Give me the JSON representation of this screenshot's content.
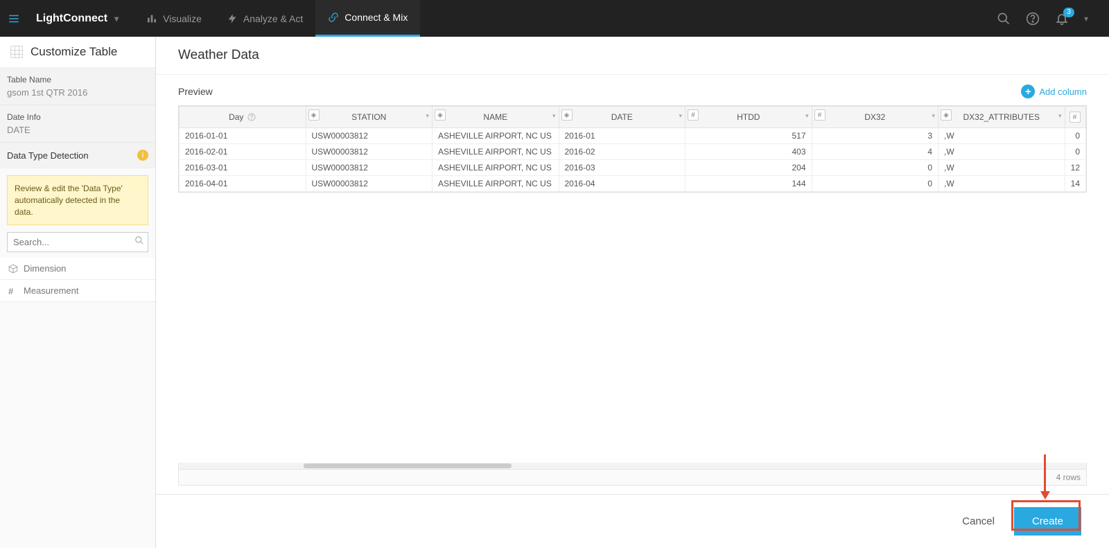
{
  "app": {
    "brand": "LightConnect"
  },
  "nav": {
    "tabs": [
      {
        "label": "Visualize"
      },
      {
        "label": "Analyze & Act"
      },
      {
        "label": "Connect & Mix"
      }
    ],
    "notifications_count": "3"
  },
  "sidebar": {
    "title": "Customize Table",
    "table_name_label": "Table Name",
    "table_name_value": "gsom 1st QTR 2016",
    "date_info_label": "Date Info",
    "date_info_value": "DATE",
    "data_type_label": "Data Type Detection",
    "note": "Review & edit the 'Data Type' automatically detected in the data.",
    "search_placeholder": "Search...",
    "dimension_label": "Dimension",
    "measurement_label": "Measurement"
  },
  "main": {
    "title": "Weather Data",
    "preview_label": "Preview",
    "add_column": "Add column",
    "row_count_label": "4 rows"
  },
  "columns": [
    {
      "label": "Day",
      "type": "?"
    },
    {
      "label": "STATION",
      "type": "cube"
    },
    {
      "label": "NAME",
      "type": "cube"
    },
    {
      "label": "DATE",
      "type": "cube"
    },
    {
      "label": "HTDD",
      "type": "#"
    },
    {
      "label": "DX32",
      "type": "#"
    },
    {
      "label": "DX32_ATTRIBUTES",
      "type": "cube"
    },
    {
      "label": "",
      "type": "#"
    }
  ],
  "rows": [
    {
      "day": "2016-01-01",
      "station": "USW00003812",
      "name": "ASHEVILLE AIRPORT, NC US",
      "date": "2016-01",
      "htdd": "517",
      "dx32": "3",
      "dxa": ",W",
      "last": "0"
    },
    {
      "day": "2016-02-01",
      "station": "USW00003812",
      "name": "ASHEVILLE AIRPORT, NC US",
      "date": "2016-02",
      "htdd": "403",
      "dx32": "4",
      "dxa": ",W",
      "last": "0"
    },
    {
      "day": "2016-03-01",
      "station": "USW00003812",
      "name": "ASHEVILLE AIRPORT, NC US",
      "date": "2016-03",
      "htdd": "204",
      "dx32": "0",
      "dxa": ",W",
      "last": "12"
    },
    {
      "day": "2016-04-01",
      "station": "USW00003812",
      "name": "ASHEVILLE AIRPORT, NC US",
      "date": "2016-04",
      "htdd": "144",
      "dx32": "0",
      "dxa": ",W",
      "last": "14"
    }
  ],
  "actions": {
    "cancel": "Cancel",
    "create": "Create"
  }
}
